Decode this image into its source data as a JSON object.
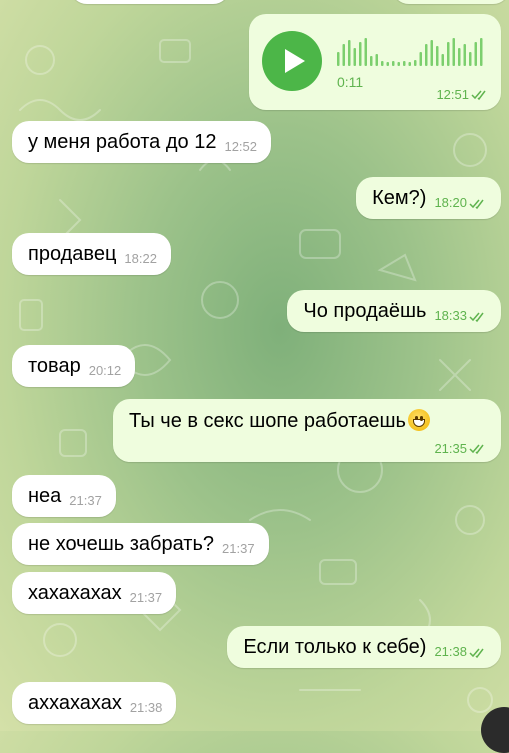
{
  "colors": {
    "incoming_bubble": "#ffffff",
    "outgoing_bubble": "#effdde",
    "outgoing_time": "#5fb34e",
    "incoming_time": "#a2a2a2",
    "play_button": "#4cb648"
  },
  "voice": {
    "duration": "0:11",
    "time": "12:51",
    "icon": "play-icon"
  },
  "messages": [
    {
      "text": "у меня работа до 12",
      "time": "12:52"
    },
    {
      "text": "Кем?)",
      "time": "18:20"
    },
    {
      "text": "продавец",
      "time": "18:22"
    },
    {
      "text": "Чо продаёшь",
      "time": "18:33"
    },
    {
      "text": "товар",
      "time": "20:12"
    },
    {
      "text": "Ты че в секс шопе работаешь",
      "emoji": "grinning-face",
      "time": "21:35"
    },
    {
      "text": "неа",
      "time": "21:37"
    },
    {
      "text": "не хочешь забрать?",
      "time": "21:37"
    },
    {
      "text": "хахахахах",
      "time": "21:37"
    },
    {
      "text": "Если только к себе)",
      "time": "21:38"
    },
    {
      "text": "аххахахах",
      "time": "21:38"
    }
  ]
}
